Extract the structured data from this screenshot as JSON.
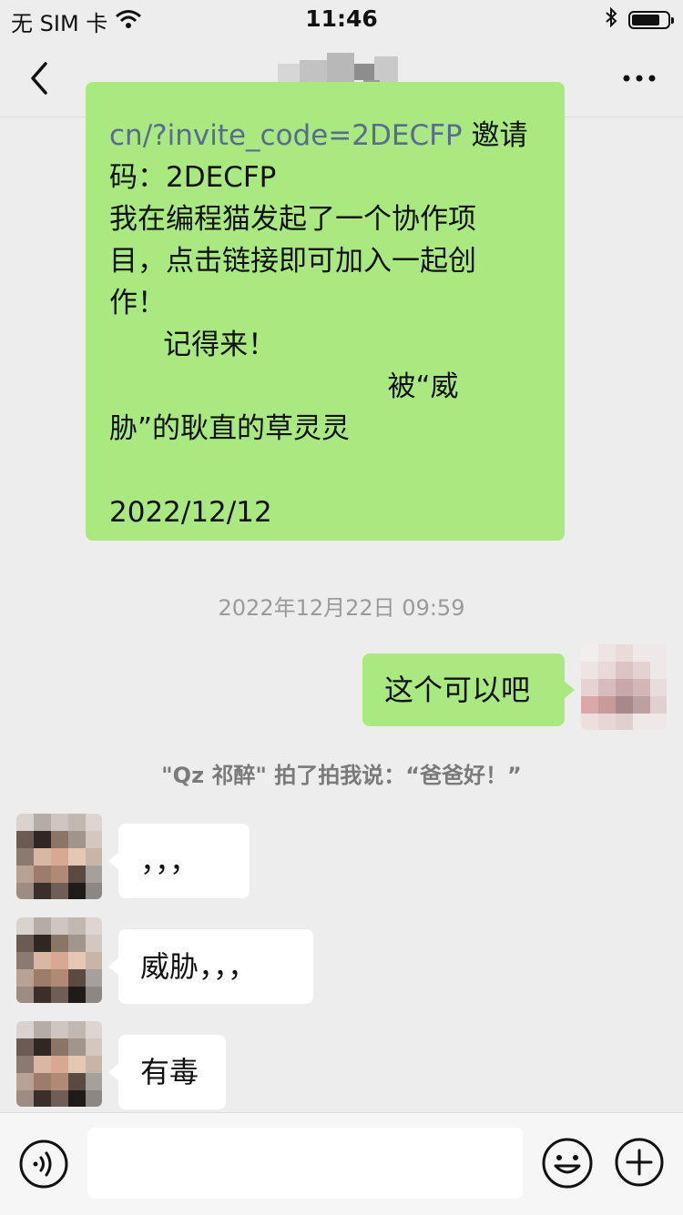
{
  "status_bar": {
    "carrier": "无 SIM 卡",
    "time": "11:46"
  },
  "nav": {
    "back": "back",
    "more": "more"
  },
  "messages": {
    "long_message": {
      "lines": [
        "cn/?invite_code=2DECFP 邀请",
        "码：2DECFP",
        "我在编程猫发起了一个协作项",
        "目，点击链接即可加入一起创",
        "作！",
        "      记得来！",
        "                               被“威",
        "胁”的耿直的草灵灵",
        "",
        "2022/12/12"
      ],
      "link_part": "cn/?invite_code=2DECFP",
      "link_rest": " 邀请"
    },
    "timestamp": "2022年12月22日 09:59",
    "sent_1": "这个可以吧",
    "pat_notice": "\"Qz 祁醉\" 拍了拍我说：“爸爸好！”",
    "recv_1": "，，，",
    "recv_2": "威胁，，，",
    "recv_3": "有毒"
  },
  "input": {
    "placeholder": "",
    "value": ""
  },
  "colors": {
    "sent_bubble": "#A9E97F",
    "received_bubble": "#FFFFFF",
    "background": "#EDEDED",
    "link": "#576B95"
  }
}
